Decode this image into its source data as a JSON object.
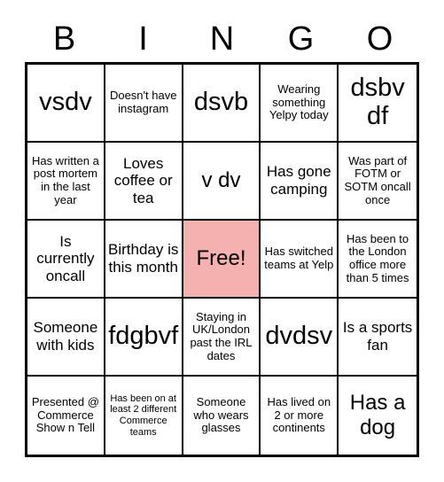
{
  "card": {
    "header_letters": [
      "B",
      "I",
      "N",
      "G",
      "O"
    ],
    "free_space_color": "#f5b0b0",
    "border_color": "#000000",
    "background_color": "#ffffff",
    "cells": [
      {
        "text": "vsdv",
        "size": "xl",
        "free": false
      },
      {
        "text": "Doesn't have instagram",
        "size": "s",
        "free": false
      },
      {
        "text": "dsvb",
        "size": "xl",
        "free": false
      },
      {
        "text": "Wearing something Yelpy today",
        "size": "s",
        "free": false
      },
      {
        "text": "dsbv df",
        "size": "xl",
        "free": false
      },
      {
        "text": "Has written a post mortem in the last year",
        "size": "s",
        "free": false
      },
      {
        "text": "Loves coffee or tea",
        "size": "m",
        "free": false
      },
      {
        "text": "v dv",
        "size": "l",
        "free": false
      },
      {
        "text": "Has gone camping",
        "size": "m",
        "free": false
      },
      {
        "text": "Was part of FOTM or SOTM oncall once",
        "size": "s",
        "free": false
      },
      {
        "text": "Is currently oncall",
        "size": "m",
        "free": false
      },
      {
        "text": "Birthday is this month",
        "size": "m",
        "free": false
      },
      {
        "text": "Free!",
        "size": "l",
        "free": true
      },
      {
        "text": "Has switched teams at Yelp",
        "size": "s",
        "free": false
      },
      {
        "text": "Has been to the London office more than 5 times",
        "size": "s",
        "free": false
      },
      {
        "text": "Someone with kids",
        "size": "m",
        "free": false
      },
      {
        "text": "fdgbvf",
        "size": "xl",
        "free": false
      },
      {
        "text": "Staying in UK/London past the IRL dates",
        "size": "s",
        "free": false
      },
      {
        "text": "dvdsv",
        "size": "xl",
        "free": false
      },
      {
        "text": "Is a sports fan",
        "size": "m",
        "free": false
      },
      {
        "text": "Presented @ Commerce Show n Tell",
        "size": "s",
        "free": false
      },
      {
        "text": "Has been on at least 2 different Commerce teams",
        "size": "xs",
        "free": false
      },
      {
        "text": "Someone who wears glasses",
        "size": "s",
        "free": false
      },
      {
        "text": "Has lived on 2 or more continents",
        "size": "s",
        "free": false
      },
      {
        "text": "Has a dog",
        "size": "l",
        "free": false
      }
    ]
  }
}
